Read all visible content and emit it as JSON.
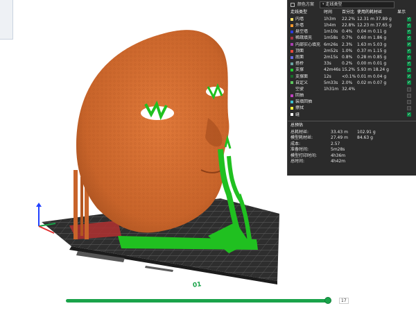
{
  "panel": {
    "scheme_label": "颜色方案",
    "scheme_value": "走线类型",
    "headers": [
      "走线类型",
      "时间",
      "百分比",
      "使用的耗材丝",
      "显示"
    ],
    "rows": [
      {
        "name": "内墙",
        "time": "1h3m",
        "pct": "22.2%",
        "len": "12.31 m",
        "wt": "37.89 g",
        "color": "#ffe066",
        "on": true
      },
      {
        "name": "外墙",
        "time": "1h4m",
        "pct": "22.8%",
        "len": "12.23 m",
        "wt": "37.65 g",
        "color": "#ff9a2e",
        "on": true
      },
      {
        "name": "悬空墙",
        "time": "1m10s",
        "pct": "0.4%",
        "len": "0.04 m",
        "wt": "0.11 g",
        "color": "#2b3be0",
        "on": true
      },
      {
        "name": "稀疏填充",
        "time": "1m58s",
        "pct": "0.7%",
        "len": "0.60 m",
        "wt": "1.86 g",
        "color": "#a33344",
        "on": true
      },
      {
        "name": "内部实心填充",
        "time": "6m26s",
        "pct": "2.3%",
        "len": "1.63 m",
        "wt": "5.03 g",
        "color": "#a83eb0",
        "on": true
      },
      {
        "name": "顶面",
        "time": "2m52s",
        "pct": "1.0%",
        "len": "0.37 m",
        "wt": "1.15 g",
        "color": "#e8483a",
        "on": true
      },
      {
        "name": "底面",
        "time": "2m15s",
        "pct": "0.8%",
        "len": "0.28 m",
        "wt": "0.85 g",
        "color": "#6a6ae0",
        "on": true
      },
      {
        "name": "搭桥",
        "time": "33s",
        "pct": "0.2%",
        "len": "0.00 m",
        "wt": "0.01 g",
        "color": "#6aa3a3",
        "on": true
      },
      {
        "name": "支撑",
        "time": "42m46s",
        "pct": "15.2%",
        "len": "5.93 m",
        "wt": "18.24 g",
        "color": "#1fcf2f",
        "on": true
      },
      {
        "name": "支撑面",
        "time": "12s",
        "pct": "<0.1%",
        "len": "0.01 m",
        "wt": "0.04 g",
        "color": "#1a6b2a",
        "on": true
      },
      {
        "name": "自定义",
        "time": "5m33s",
        "pct": "2.0%",
        "len": "0.02 m",
        "wt": "0.07 g",
        "color": "#5ec75e",
        "on": true
      },
      {
        "name": "空驶",
        "time": "1h31m",
        "pct": "32.4%",
        "len": "",
        "wt": "",
        "color": "",
        "on": false
      },
      {
        "name": "回抽",
        "time": "",
        "pct": "",
        "len": "",
        "wt": "",
        "color": "#c040c0",
        "on": false
      },
      {
        "name": "装填回抽",
        "time": "",
        "pct": "",
        "len": "",
        "wt": "",
        "color": "#3cc0d0",
        "on": false
      },
      {
        "name": "擦拭",
        "time": "",
        "pct": "",
        "len": "",
        "wt": "",
        "color": "#ffff40",
        "on": false
      },
      {
        "name": "缝",
        "time": "",
        "pct": "",
        "len": "",
        "wt": "",
        "color": "#ffffff",
        "on": true
      }
    ],
    "summary_title": "总预估",
    "summary": [
      {
        "label": "总耗材丝:",
        "a": "33.43 m",
        "b": "102.91 g"
      },
      {
        "label": "模型耗材丝:",
        "a": "27.49 m",
        "b": "84.63 g"
      },
      {
        "label": "成本:",
        "a": "2.57",
        "b": ""
      },
      {
        "label": "准备时间:",
        "a": "5m28s",
        "b": ""
      },
      {
        "label": "模型打印时间:",
        "a": "4h36m",
        "b": ""
      },
      {
        "label": "总时间:",
        "a": "4h42m",
        "b": ""
      }
    ]
  },
  "slider": {
    "value": "17",
    "position": 0.98
  },
  "plate": {
    "number": "01"
  },
  "colors": {
    "model": "#c8642a",
    "support": "#20c020",
    "bed": "#3a3a3a",
    "accent": "#1aa34a"
  }
}
